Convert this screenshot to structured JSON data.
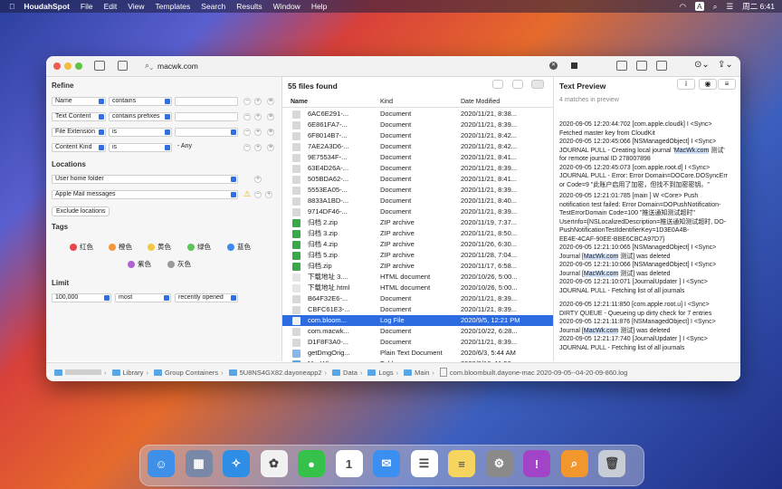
{
  "menubar": {
    "app": "HoudahSpot",
    "items": [
      "File",
      "Edit",
      "View",
      "Templates",
      "Search",
      "Results",
      "Window",
      "Help"
    ],
    "clock": "周二 6:41"
  },
  "toolbar": {
    "search_value": "macwk.com"
  },
  "refine": {
    "title": "Refine",
    "rows": [
      {
        "attr": "Name",
        "op": "contains",
        "value": ""
      },
      {
        "attr": "Text Content",
        "op": "contains prefixes",
        "value": ""
      },
      {
        "attr": "File Extension",
        "op": "is",
        "value": ""
      },
      {
        "attr": "Content Kind",
        "op": "is",
        "value": "- Any"
      }
    ]
  },
  "locations": {
    "title": "Locations",
    "items": [
      "User home folder",
      "Apple Mail messages"
    ],
    "exclude_label": "Exclude locations"
  },
  "tags": {
    "title": "Tags",
    "items": [
      {
        "label": "红色",
        "color": "#e8474b"
      },
      {
        "label": "橙色",
        "color": "#f3973d"
      },
      {
        "label": "黄色",
        "color": "#f5c842"
      },
      {
        "label": "绿色",
        "color": "#5fc35b"
      },
      {
        "label": "蓝色",
        "color": "#3d8af0"
      },
      {
        "label": "紫色",
        "color": "#b163d4"
      },
      {
        "label": "灰色",
        "color": "#9a9a9a"
      }
    ]
  },
  "limit": {
    "title": "Limit",
    "count": "100,000",
    "mode": "most",
    "order": "recently opened"
  },
  "results": {
    "count_label": "55 files found",
    "columns": [
      "Name",
      "Kind",
      "Date Modified"
    ],
    "rows": [
      {
        "name": "6AC6E291-...",
        "kind": "Document",
        "date": "2020/11/21, 8:38..."
      },
      {
        "name": "6E861FA7-...",
        "kind": "Document",
        "date": "2020/11/21, 8:39..."
      },
      {
        "name": "6F8014B7-...",
        "kind": "Document",
        "date": "2020/11/21, 8:42..."
      },
      {
        "name": "7AE2A3D6-...",
        "kind": "Document",
        "date": "2020/11/21, 8:42..."
      },
      {
        "name": "9E75534F-...",
        "kind": "Document",
        "date": "2020/11/21, 8:41..."
      },
      {
        "name": "63E4D26A-...",
        "kind": "Document",
        "date": "2020/11/21, 8:39..."
      },
      {
        "name": "505BDA62-...",
        "kind": "Document",
        "date": "2020/11/21, 8:41..."
      },
      {
        "name": "5553EA05-...",
        "kind": "Document",
        "date": "2020/11/21, 8:39..."
      },
      {
        "name": "8833A1BD-...",
        "kind": "Document",
        "date": "2020/11/21, 8:40..."
      },
      {
        "name": "9714DF46-...",
        "kind": "Document",
        "date": "2020/11/21, 8:39..."
      },
      {
        "name": "归档 2.zip",
        "kind": "ZIP archive",
        "date": "2020/11/19, 7:37..."
      },
      {
        "name": "归档 3.zip",
        "kind": "ZIP archive",
        "date": "2020/11/21, 8:50..."
      },
      {
        "name": "归档 4.zip",
        "kind": "ZIP archive",
        "date": "2020/11/26, 6:30..."
      },
      {
        "name": "归档 5.zip",
        "kind": "ZIP archive",
        "date": "2020/11/28, 7:04..."
      },
      {
        "name": "归档.zip",
        "kind": "ZIP archive",
        "date": "2020/11/17, 6:58..."
      },
      {
        "name": "下载地址 3....",
        "kind": "HTML document",
        "date": "2020/10/26, 5:00..."
      },
      {
        "name": "下载地址.html",
        "kind": "HTML document",
        "date": "2020/10/26, 5:00..."
      },
      {
        "name": "B64F32E6-...",
        "kind": "Document",
        "date": "2020/11/21, 8:39..."
      },
      {
        "name": "CBFC61E3-...",
        "kind": "Document",
        "date": "2020/11/21, 8:39..."
      },
      {
        "name": "com.bloom...",
        "kind": "Log File",
        "date": "2020/9/5, 12:21 PM"
      },
      {
        "name": "com.macwk...",
        "kind": "Document",
        "date": "2020/10/22, 6:28..."
      },
      {
        "name": "D1F8F3A0-...",
        "kind": "Document",
        "date": "2020/11/21, 8:39..."
      },
      {
        "name": "getDmgOrig...",
        "kind": "Plain Text Document",
        "date": "2020/6/3, 5:44 AM"
      },
      {
        "name": "MacWk.com",
        "kind": "Folder",
        "date": "2020/9/10, 11:53..."
      }
    ]
  },
  "preview": {
    "title": "Text Preview",
    "matches": "4 matches in preview",
    "blocks": [
      [
        "2020-09-05 12:20:44:702 [com.apple.cloudk] I <Sync>",
        "Fetched master key from CloudKit",
        "2020-09-05 12:20:45:066 [NSManagedObject] I <Sync>",
        "JOURNAL PULL - Creating local journal 'MacWk.com 测试'",
        "for remote journal ID 278007898",
        "2020-09-05 12:20:45:073 [com.apple.root.d] I <Sync>",
        "JOURNAL PULL - Error: Error Domain=DOCore.DOSyncErr",
        "or Code=9 \"此账户启用了加密，但找不到加密密钥。\""
      ],
      [
        "2020-09-05 12:21:01:785 [main ] W <Core> Push",
        "notification test failed: Error Domain=DOPushNotification-",
        "TestErrorDomain Code=100 \"推送通知测试超时\"",
        "UserInfo={NSLocalizedDescription=推送通知测试超时, DO-",
        "PushNotificationTestIdentifierKey=1D3E0A4B-",
        "EE4E-4CAF-90EE-BBE6CBCA97D7}",
        "2020-09-05 12:21:10:065 [NSManagedObject] I <Sync>",
        "Journal [MacWk.com 测试] was deleted",
        "2020-09-05 12:21:10:066 [NSManagedObject] I <Sync>",
        "Journal [MacWk.com 测试] was deleted",
        "2020-09-05 12:21:10:071 [JournalUpdater ] I <Sync>",
        "JOURNAL PULL - Fetching list of all journals"
      ],
      [
        "2020-09-05 12:21:11:850 [com.apple.root.u] I <Sync>",
        "DIRTY QUEUE - Queueing up dirty check for 7 entries",
        "2020-09-05 12:21:11:876 [NSManagedObject] I <Sync>",
        "Journal [MacWk.com 测试] was deleted",
        "2020-09-05 12:21:17:740 [JournalUpdater ] I <Sync>",
        "JOURNAL PULL - Fetching list of all journals"
      ]
    ]
  },
  "pathbar": {
    "items": [
      "Library",
      "Group Containers",
      "5U8NS4GX82.dayoneapp2",
      "Data",
      "Logs",
      "Main",
      "com.bloombuilt.dayone-mac 2020-09-05--04-20-09-860.log"
    ]
  },
  "dock": {
    "items": [
      {
        "name": "finder-icon",
        "glyph": "☺",
        "color": "#3d8fe8"
      },
      {
        "name": "launchpad-icon",
        "glyph": "▦",
        "color": "#7a88a8"
      },
      {
        "name": "safari-icon",
        "glyph": "✧",
        "color": "#2e8ee6"
      },
      {
        "name": "photos-icon",
        "glyph": "✿",
        "color": "#f1f1f1"
      },
      {
        "name": "messages-icon",
        "glyph": "●",
        "color": "#36c24a"
      },
      {
        "name": "calendar-icon",
        "glyph": "1",
        "color": "#ffffff"
      },
      {
        "name": "mail-icon",
        "glyph": "✉",
        "color": "#3b8ff0"
      },
      {
        "name": "reminders-icon",
        "glyph": "☰",
        "color": "#ffffff"
      },
      {
        "name": "notes-icon",
        "glyph": "≡",
        "color": "#f5d560"
      },
      {
        "name": "system-preferences-icon",
        "glyph": "⚙",
        "color": "#8a8a8a"
      },
      {
        "name": "feedback-icon",
        "glyph": "!",
        "color": "#a144c8"
      },
      {
        "name": "houdahspot-icon",
        "glyph": "⌕",
        "color": "#f2962e"
      },
      {
        "name": "trash-icon",
        "glyph": "🗑",
        "color": "#c8ccd4"
      }
    ]
  }
}
